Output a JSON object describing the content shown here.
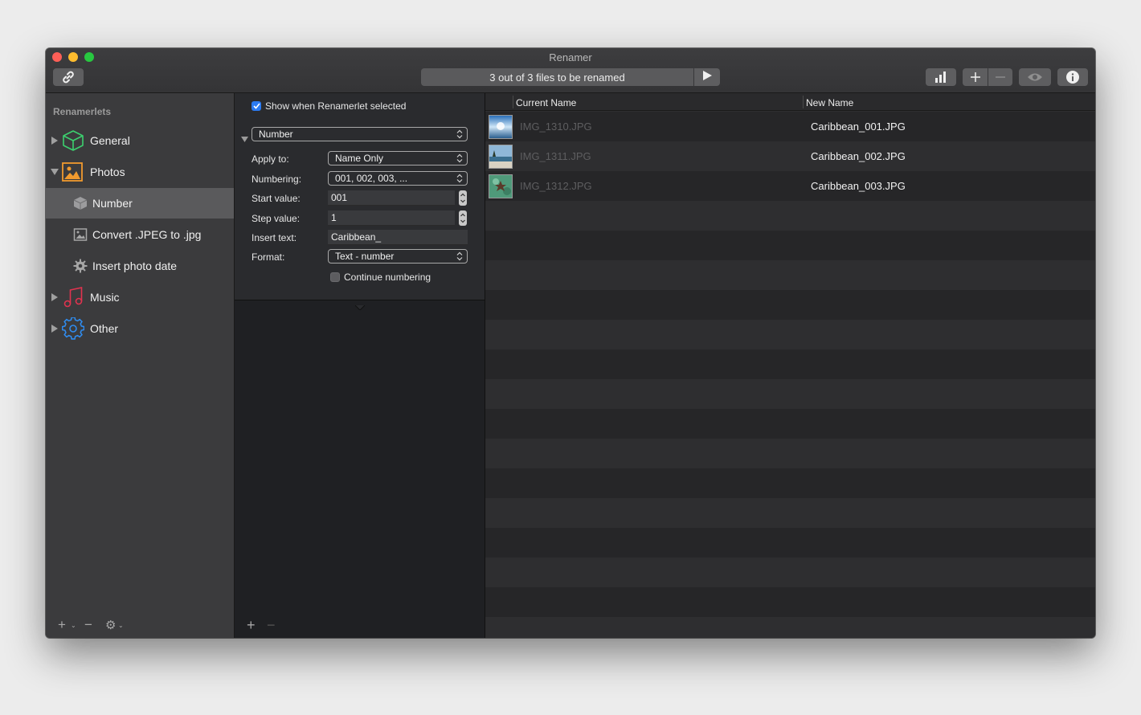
{
  "window": {
    "title": "Renamer",
    "status": "3 out of 3 files to be renamed"
  },
  "toolbar": {
    "link_icon": "link-icon",
    "play_icon": "play-icon",
    "stats_icon": "bar-chart-icon",
    "add_icon": "plus-icon",
    "remove_icon": "minus-icon",
    "preview_icon": "eye-icon",
    "info_icon": "info-icon"
  },
  "sidebar": {
    "heading": "Renamerlets",
    "items": [
      {
        "label": "General",
        "icon": "cube-icon",
        "expanded": false
      },
      {
        "label": "Photos",
        "icon": "photo-icon",
        "expanded": true
      },
      {
        "label": "Number",
        "icon": "box-icon",
        "child": true,
        "selected": true
      },
      {
        "label": "Convert .JPEG to .jpg",
        "icon": "image-icon",
        "child": true
      },
      {
        "label": "Insert photo date",
        "icon": "gear-icon",
        "child": true
      },
      {
        "label": "Music",
        "icon": "music-note-icon",
        "expanded": false
      },
      {
        "label": "Other",
        "icon": "gear-icon",
        "expanded": false
      }
    ],
    "footer": {
      "add": "+",
      "remove": "−",
      "action": "⚙"
    }
  },
  "editor": {
    "show_when_selected_label": "Show when Renamerlet selected",
    "show_when_selected": true,
    "renamerlet_type": "Number",
    "apply_to_label": "Apply to:",
    "apply_to_value": "Name Only",
    "numbering_label": "Numbering:",
    "numbering_value": "001, 002, 003, ...",
    "start_value_label": "Start value:",
    "start_value": "001",
    "step_value_label": "Step value:",
    "step_value": "1",
    "insert_text_label": "Insert text:",
    "insert_text_value": "Caribbean_",
    "format_label": "Format:",
    "format_value": "Text - number",
    "continue_numbering_label": "Continue numbering",
    "continue_numbering": false,
    "footer": {
      "add": "+",
      "remove": "−"
    }
  },
  "filelist": {
    "columns": [
      "Current Name",
      "New Name"
    ],
    "rows": [
      {
        "current": "IMG_1310.JPG",
        "new": "Caribbean_001.JPG"
      },
      {
        "current": "IMG_1311.JPG",
        "new": "Caribbean_002.JPG"
      },
      {
        "current": "IMG_1312.JPG",
        "new": "Caribbean_003.JPG"
      }
    ]
  },
  "colors": {
    "accent": "#2b7bf2",
    "general_icon": "#3ccf6e",
    "photos_icon": "#f09a2e",
    "music_icon": "#e0334f",
    "other_icon": "#2f8cf0"
  }
}
